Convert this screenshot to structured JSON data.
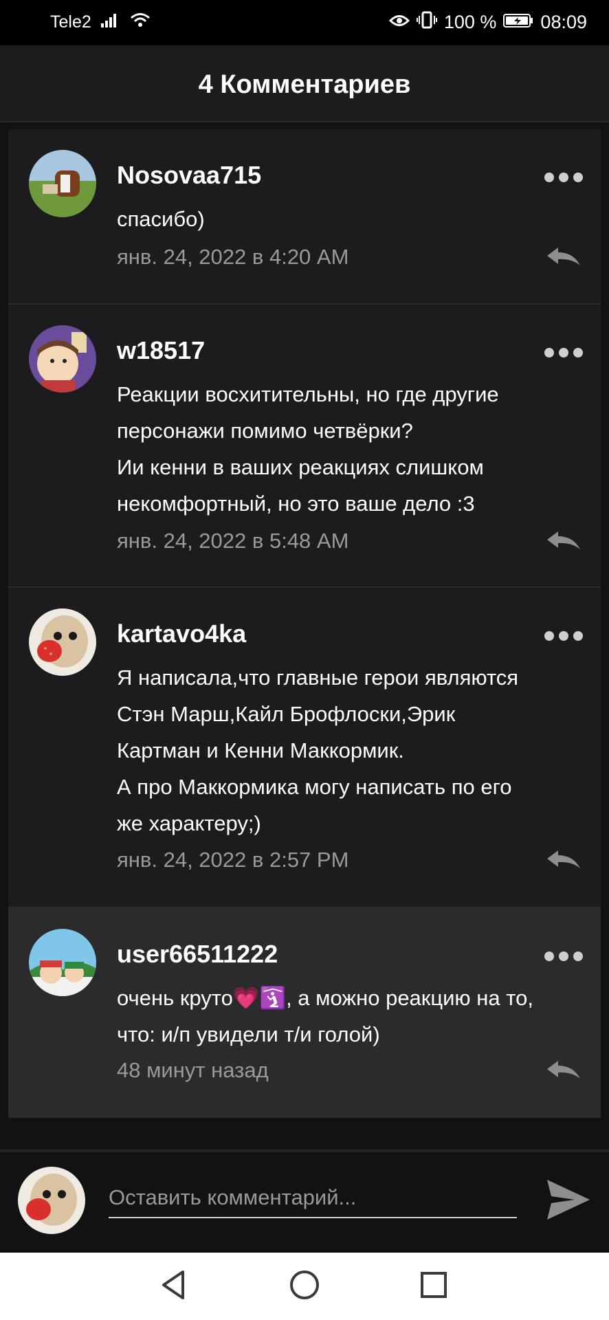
{
  "status_bar": {
    "carrier": "Tele2",
    "battery": "100 %",
    "time": "08:09"
  },
  "header": {
    "title": "4 Комментариев"
  },
  "comments": [
    {
      "username": "Nosovaa715",
      "lines": [
        "спасибо)"
      ],
      "timestamp": "янв. 24, 2022 в 4:20 AM"
    },
    {
      "username": "w18517",
      "lines": [
        "Реакции восхитительны, но где другие",
        "персонажи помимо четвёрки?",
        "Ии кенни в ваших реакциях слишком",
        "некомфортный, но это ваше дело :3"
      ],
      "timestamp": "янв. 24, 2022 в 5:48 AM"
    },
    {
      "username": "kartavo4ka",
      "lines": [
        "Я написала,что главные герои являются",
        "Стэн Марш,Кайл Брофлоски,Эрик",
        "Картман и Кенни Маккормик.",
        "А про Маккормика могу написать по его",
        "же характеру;)"
      ],
      "timestamp": "янв. 24, 2022 в 2:57 PM"
    },
    {
      "username": "user66511222",
      "lines": [
        "очень круто💗🛐, а можно реакцию на то,",
        "что: и/п увидели т/и голой)"
      ],
      "timestamp": "48 минут назад"
    }
  ],
  "composer": {
    "placeholder": "Оставить комментарий..."
  },
  "icons": {
    "more": "more-options-icon",
    "reply": "reply-icon",
    "send": "send-icon",
    "back": "nav-back-icon",
    "home": "nav-home-icon",
    "recents": "nav-recents-icon"
  },
  "colors": {
    "background": "#121212",
    "card": "#1c1c1e",
    "highlight_card": "#2b2b2d",
    "muted_text": "#9a9a9c"
  }
}
